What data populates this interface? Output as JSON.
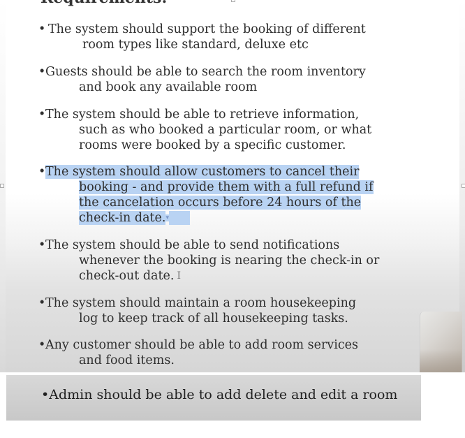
{
  "slide": {
    "heading": "Requirements:",
    "items": [
      {
        "line1": "The system should support the booking of different",
        "line2": "room types like standard, deluxe etc"
      },
      {
        "line1": "Guests should be able to search the room inventory",
        "line2": "and book any available room"
      },
      {
        "line1": "The system should be able to retrieve information,",
        "line2": "such as who booked a particular room, or what",
        "line3": "rooms were booked by a specific customer."
      },
      {
        "line1": "The system should allow customers to cancel their",
        "line2": "booking - and provide them with a full refund if",
        "line3": "the cancelation occurs before 24 hours of the",
        "line4": "check-in date."
      },
      {
        "line1": "The system should be able to send notifications",
        "line2": "whenever the booking is nearing the check-in or",
        "line3": "check-out date."
      },
      {
        "line1": "The system should maintain a room housekeeping",
        "line2": "log to keep track of all housekeeping tasks."
      },
      {
        "line1": "Any customer should be able to add room services",
        "line2": "and food items."
      }
    ],
    "highlight_color": "#b9d3f3"
  },
  "bottom_slide": {
    "text": "Admin should be able to add delete and edit a room"
  },
  "glyphs": {
    "bullet": "•",
    "cursor": "I"
  }
}
